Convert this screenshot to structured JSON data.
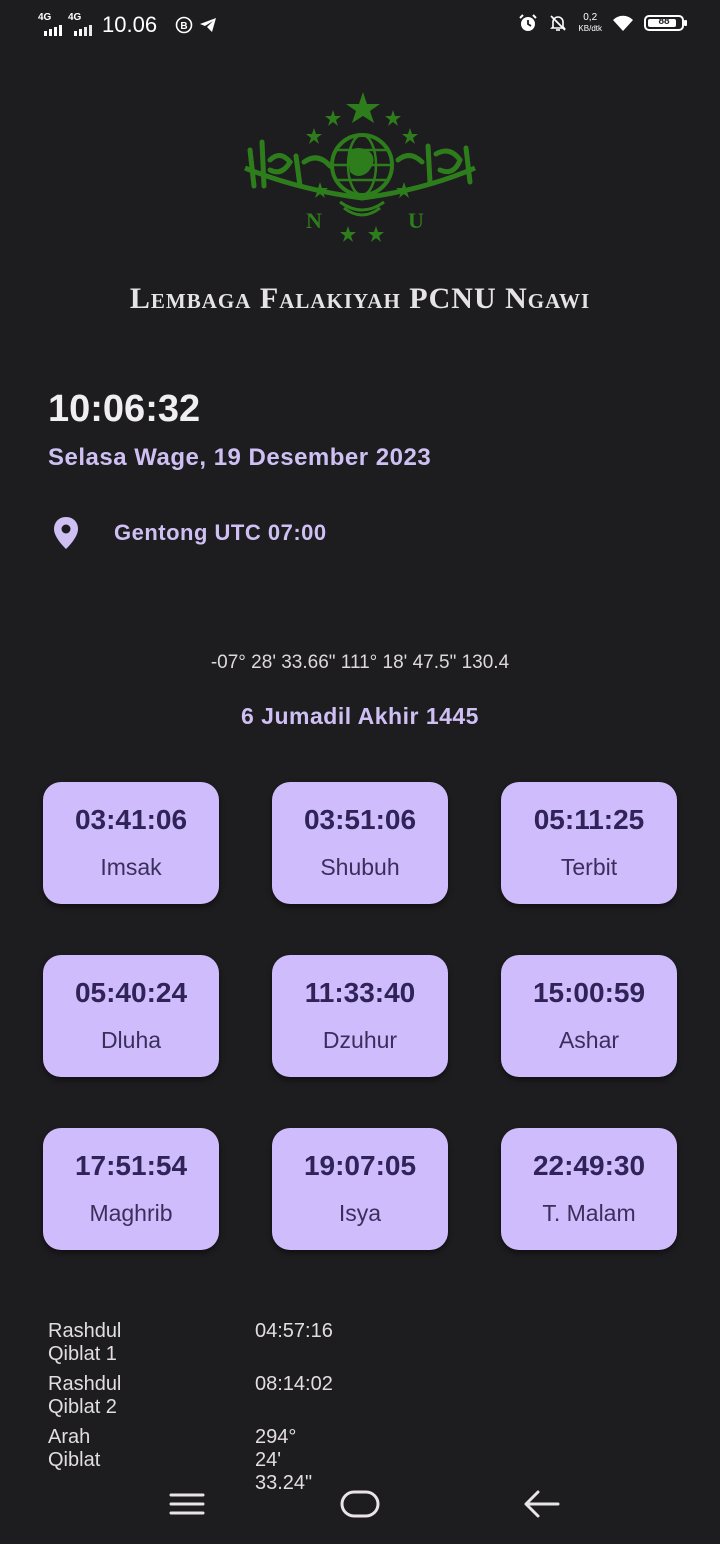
{
  "status_bar": {
    "network_1": "4G",
    "network_2": "4G",
    "time": "10.06",
    "speed_value": "0,2",
    "speed_unit": "KB/dtk",
    "battery": "88",
    "battery_level": 0.88
  },
  "header": {
    "logo_letters": [
      "N",
      "U"
    ],
    "title": "Lembaga Falakiyah PCNU Ngawi"
  },
  "clock": {
    "time": "10:06:32",
    "date": "Selasa Wage, 19 Desember 2023"
  },
  "location": {
    "name": "Gentong UTC 07:00",
    "icon": "location-pin-icon",
    "coordinates": "-07° 28' 33.66\" 111° 18' 47.5\" 130.4"
  },
  "hijri_date": "6 Jumadil Akhir 1445",
  "prayer_times": [
    {
      "time": "03:41:06",
      "name": "Imsak"
    },
    {
      "time": "03:51:06",
      "name": "Shubuh"
    },
    {
      "time": "05:11:25",
      "name": "Terbit"
    },
    {
      "time": "05:40:24",
      "name": "Dluha"
    },
    {
      "time": "11:33:40",
      "name": "Dzuhur"
    },
    {
      "time": "15:00:59",
      "name": "Ashar"
    },
    {
      "time": "17:51:54",
      "name": "Maghrib"
    },
    {
      "time": "19:07:05",
      "name": "Isya"
    },
    {
      "time": "22:49:30",
      "name": "T. Malam"
    }
  ],
  "qibla": [
    {
      "label": "Rashdul Qiblat 1",
      "value": "04:57:16"
    },
    {
      "label": "Rashdul Qiblat 2",
      "value": "08:14:02"
    },
    {
      "label": "Arah Qiblat",
      "value": "294° 24' 33.24\""
    }
  ],
  "nav_bar": {
    "icons": [
      "menu-icon",
      "home-icon",
      "back-icon"
    ]
  },
  "colors": {
    "background": "#1d1c1f",
    "accent": "#cfc0f4",
    "card": "#cfbcfd",
    "card_text": "#2f2357",
    "logo_green": "#2e7d1c"
  }
}
